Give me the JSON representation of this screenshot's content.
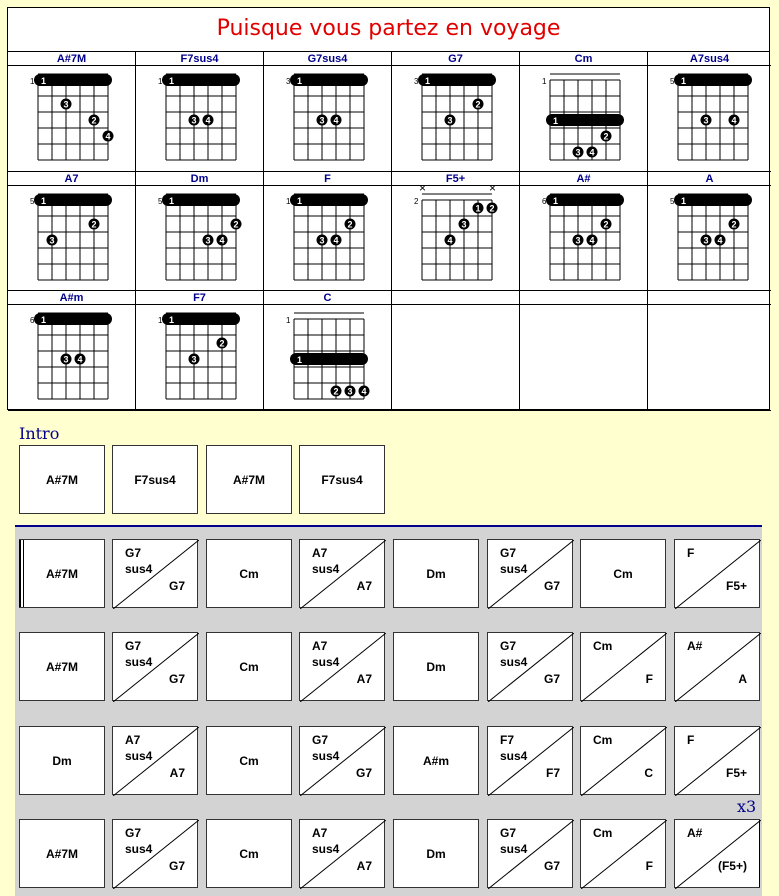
{
  "title": "Puisque vous partez en voyage",
  "chords": [
    {
      "name": "A#7M",
      "fret": "1",
      "barre": "1",
      "notes": []
    },
    {
      "name": "F7sus4",
      "fret": "1",
      "barre": "1",
      "notes": []
    },
    {
      "name": "G7sus4",
      "fret": "3",
      "barre": "1",
      "notes": []
    },
    {
      "name": "G7",
      "fret": "3",
      "barre": "1",
      "notes": []
    },
    {
      "name": "Cm",
      "fret": "1",
      "barre": "1",
      "notes": []
    },
    {
      "name": "A7sus4",
      "fret": "5",
      "barre": "1",
      "notes": []
    },
    {
      "name": "A7",
      "fret": "5",
      "barre": "1",
      "notes": []
    },
    {
      "name": "Dm",
      "fret": "5",
      "barre": "1",
      "notes": []
    },
    {
      "name": "F",
      "fret": "1",
      "barre": "1",
      "notes": []
    },
    {
      "name": "F5+",
      "fret": "2",
      "barre": "",
      "notes": []
    },
    {
      "name": "A#",
      "fret": "6",
      "barre": "1",
      "notes": []
    },
    {
      "name": "A",
      "fret": "5",
      "barre": "1",
      "notes": []
    },
    {
      "name": "A#m",
      "fret": "6",
      "barre": "1",
      "notes": []
    },
    {
      "name": "F7",
      "fret": "1",
      "barre": "1",
      "notes": []
    },
    {
      "name": "C",
      "fret": "1",
      "barre": "1",
      "notes": []
    }
  ],
  "intro": {
    "label": "Intro",
    "boxes": [
      {
        "top": "A#7M"
      },
      {
        "top": "F7sus4"
      },
      {
        "top": "A#7M"
      },
      {
        "top": "F7sus4"
      }
    ]
  },
  "grid": {
    "repeat": "x3",
    "rows": [
      [
        {
          "single": "A#7M"
        },
        {
          "top": "G7\nsus4",
          "bot": "G7"
        },
        {
          "single": "Cm"
        },
        {
          "top": "A7\nsus4",
          "bot": "A7"
        },
        {
          "single": "Dm"
        },
        {
          "top": "G7\nsus4",
          "bot": "G7"
        },
        {
          "single": "Cm"
        },
        {
          "top": "F",
          "bot": "F5+"
        }
      ],
      [
        {
          "single": "A#7M"
        },
        {
          "top": "G7\nsus4",
          "bot": "G7"
        },
        {
          "single": "Cm"
        },
        {
          "top": "A7\nsus4",
          "bot": "A7"
        },
        {
          "single": "Dm"
        },
        {
          "top": "G7\nsus4",
          "bot": "G7"
        },
        {
          "top": "Cm",
          "bot": "F"
        },
        {
          "top": "A#",
          "bot": "A"
        }
      ],
      [
        {
          "single": "Dm"
        },
        {
          "top": "A7\nsus4",
          "bot": "A7"
        },
        {
          "single": "Cm"
        },
        {
          "top": "G7\nsus4",
          "bot": "G7"
        },
        {
          "single": "A#m"
        },
        {
          "top": "F7\nsus4",
          "bot": "F7"
        },
        {
          "top": "Cm",
          "bot": "C"
        },
        {
          "top": "F",
          "bot": "F5+"
        }
      ],
      [
        {
          "single": "A#7M"
        },
        {
          "top": "G7\nsus4",
          "bot": "G7"
        },
        {
          "single": "Cm"
        },
        {
          "top": "A7\nsus4",
          "bot": "A7"
        },
        {
          "single": "Dm"
        },
        {
          "top": "G7\nsus4",
          "bot": "G7"
        },
        {
          "top": "Cm",
          "bot": "F"
        },
        {
          "top": "A#",
          "bot": "(F5+)"
        }
      ]
    ]
  }
}
